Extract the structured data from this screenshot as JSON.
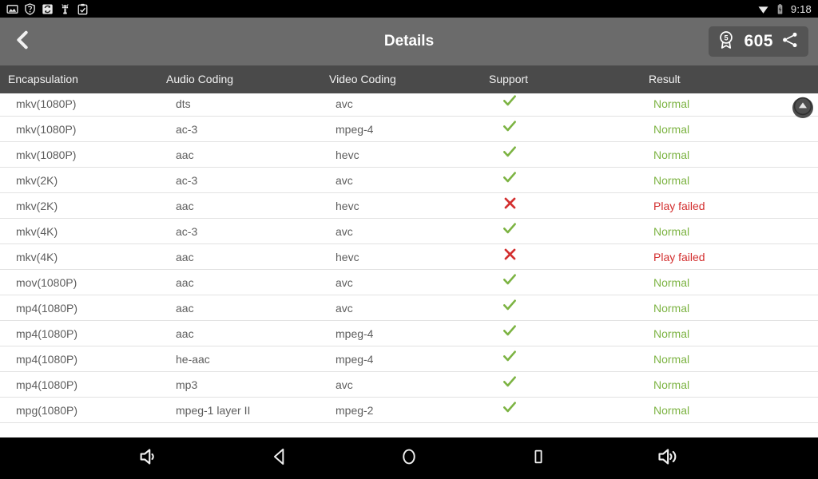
{
  "status_bar": {
    "icons": [
      "photo-icon",
      "shield-icon",
      "sync-icon",
      "usb-android-icon",
      "clipboard-check-icon"
    ],
    "wifi_icon": "wifi-icon",
    "battery_icon": "battery-charging-icon",
    "time": "9:18"
  },
  "toolbar": {
    "back_icon": "back-chevron-icon",
    "title": "Details",
    "score_badge_icon": "award-badge-icon",
    "score_badge_value": "5",
    "score": "605",
    "share_icon": "share-icon"
  },
  "table": {
    "columns": [
      "Encapsulation",
      "Audio Coding",
      "Video Coding",
      "Support",
      "Result"
    ],
    "clipped_top_row": {
      "encapsulation": "mkv(1080P)",
      "audio": "",
      "video": "",
      "support": "check-icon",
      "result": "Normal"
    },
    "rows": [
      {
        "encapsulation": "mkv(1080P)",
        "audio": "dts",
        "video": "avc",
        "support": "check-icon",
        "result": "Normal"
      },
      {
        "encapsulation": "mkv(1080P)",
        "audio": "ac-3",
        "video": "mpeg-4",
        "support": "check-icon",
        "result": "Normal"
      },
      {
        "encapsulation": "mkv(1080P)",
        "audio": "aac",
        "video": "hevc",
        "support": "check-icon",
        "result": "Normal"
      },
      {
        "encapsulation": "mkv(2K)",
        "audio": "ac-3",
        "video": "avc",
        "support": "check-icon",
        "result": "Normal"
      },
      {
        "encapsulation": "mkv(2K)",
        "audio": "aac",
        "video": "hevc",
        "support": "cross-icon",
        "result": "Play failed"
      },
      {
        "encapsulation": "mkv(4K)",
        "audio": "ac-3",
        "video": "avc",
        "support": "check-icon",
        "result": "Normal"
      },
      {
        "encapsulation": "mkv(4K)",
        "audio": "aac",
        "video": "hevc",
        "support": "cross-icon",
        "result": "Play failed"
      },
      {
        "encapsulation": "mov(1080P)",
        "audio": "aac",
        "video": "avc",
        "support": "check-icon",
        "result": "Normal"
      },
      {
        "encapsulation": "mp4(1080P)",
        "audio": "aac",
        "video": "avc",
        "support": "check-icon",
        "result": "Normal"
      },
      {
        "encapsulation": "mp4(1080P)",
        "audio": "aac",
        "video": "mpeg-4",
        "support": "check-icon",
        "result": "Normal"
      },
      {
        "encapsulation": "mp4(1080P)",
        "audio": "he-aac",
        "video": "mpeg-4",
        "support": "check-icon",
        "result": "Normal"
      },
      {
        "encapsulation": "mp4(1080P)",
        "audio": "mp3",
        "video": "avc",
        "support": "check-icon",
        "result": "Normal"
      },
      {
        "encapsulation": "mpg(1080P)",
        "audio": "mpeg-1 layer II",
        "video": "mpeg-2",
        "support": "check-icon",
        "result": "Normal"
      }
    ]
  },
  "scroll_to_top": {
    "icon": "arrow-up-circle-icon"
  },
  "nav_bar": {
    "buttons": [
      "volume-down-icon",
      "back-triangle-icon",
      "home-circle-icon",
      "recents-square-icon",
      "volume-up-icon"
    ]
  },
  "colors": {
    "toolbar_bg": "#6b6b6b",
    "header_bg": "#4a4a4a",
    "ok": "#7cb342",
    "fail": "#d32f2f",
    "row_text": "#5d5d5d"
  }
}
